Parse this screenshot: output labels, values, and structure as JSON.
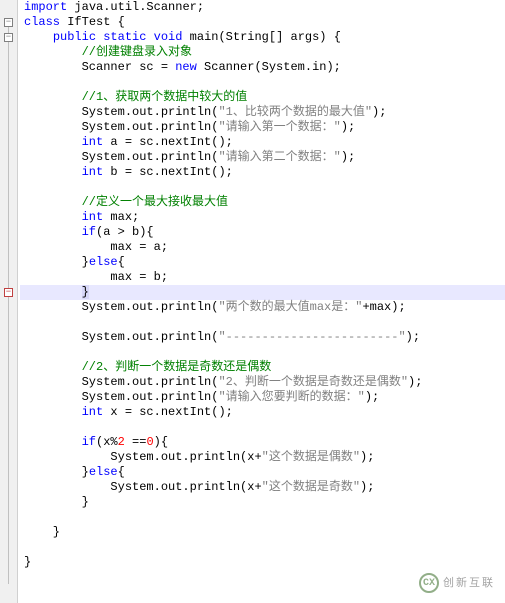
{
  "code": {
    "lines": [
      {
        "tokens": [
          {
            "t": "import",
            "c": "kw"
          },
          {
            "t": " java.util.Scanner;",
            "c": ""
          }
        ]
      },
      {
        "tokens": [
          {
            "t": "class",
            "c": "kw"
          },
          {
            "t": " IfTest {",
            "c": ""
          }
        ]
      },
      {
        "tokens": [
          {
            "t": "    ",
            "c": ""
          },
          {
            "t": "public",
            "c": "kw"
          },
          {
            "t": " ",
            "c": ""
          },
          {
            "t": "static",
            "c": "kw"
          },
          {
            "t": " ",
            "c": ""
          },
          {
            "t": "void",
            "c": "kw"
          },
          {
            "t": " main(String[] args) {",
            "c": ""
          }
        ]
      },
      {
        "tokens": [
          {
            "t": "        ",
            "c": ""
          },
          {
            "t": "//创建键盘录入对象",
            "c": "comment"
          }
        ]
      },
      {
        "tokens": [
          {
            "t": "        Scanner sc = ",
            "c": ""
          },
          {
            "t": "new",
            "c": "kw"
          },
          {
            "t": " Scanner(System.in);",
            "c": ""
          }
        ]
      },
      {
        "tokens": [
          {
            "t": " ",
            "c": ""
          }
        ]
      },
      {
        "tokens": [
          {
            "t": "        ",
            "c": ""
          },
          {
            "t": "//1、获取两个数据中较大的值",
            "c": "comment"
          }
        ]
      },
      {
        "tokens": [
          {
            "t": "        System.out.println(",
            "c": ""
          },
          {
            "t": "\"1、比较两个数据的最大值\"",
            "c": "str"
          },
          {
            "t": ");",
            "c": ""
          }
        ]
      },
      {
        "tokens": [
          {
            "t": "        System.out.println(",
            "c": ""
          },
          {
            "t": "\"请输入第一个数据：\"",
            "c": "str"
          },
          {
            "t": ");",
            "c": ""
          }
        ]
      },
      {
        "tokens": [
          {
            "t": "        ",
            "c": ""
          },
          {
            "t": "int",
            "c": "kw"
          },
          {
            "t": " a = sc.nextInt();",
            "c": ""
          }
        ]
      },
      {
        "tokens": [
          {
            "t": "        System.out.println(",
            "c": ""
          },
          {
            "t": "\"请输入第二个数据：\"",
            "c": "str"
          },
          {
            "t": ");",
            "c": ""
          }
        ]
      },
      {
        "tokens": [
          {
            "t": "        ",
            "c": ""
          },
          {
            "t": "int",
            "c": "kw"
          },
          {
            "t": " b = sc.nextInt();",
            "c": ""
          }
        ]
      },
      {
        "tokens": [
          {
            "t": " ",
            "c": ""
          }
        ]
      },
      {
        "tokens": [
          {
            "t": "        ",
            "c": ""
          },
          {
            "t": "//定义一个最大接收最大值",
            "c": "comment"
          }
        ]
      },
      {
        "tokens": [
          {
            "t": "        ",
            "c": ""
          },
          {
            "t": "int",
            "c": "kw"
          },
          {
            "t": " max;",
            "c": ""
          }
        ]
      },
      {
        "tokens": [
          {
            "t": "        ",
            "c": ""
          },
          {
            "t": "if",
            "c": "kw"
          },
          {
            "t": "(a > b){",
            "c": ""
          }
        ]
      },
      {
        "tokens": [
          {
            "t": "            max = a;",
            "c": ""
          }
        ]
      },
      {
        "tokens": [
          {
            "t": "        }",
            "c": ""
          },
          {
            "t": "else",
            "c": "kw"
          },
          {
            "t": "{",
            "c": ""
          }
        ]
      },
      {
        "tokens": [
          {
            "t": "            max = b;",
            "c": ""
          }
        ]
      },
      {
        "tokens": [
          {
            "t": "        ",
            "c": ""
          },
          {
            "t": "}",
            "c": "",
            "bh": true
          }
        ],
        "hl": true
      },
      {
        "tokens": [
          {
            "t": "        System.out.println(",
            "c": ""
          },
          {
            "t": "\"两个数的最大值max是：\"",
            "c": "str"
          },
          {
            "t": "+max);",
            "c": ""
          }
        ]
      },
      {
        "tokens": [
          {
            "t": " ",
            "c": ""
          }
        ]
      },
      {
        "tokens": [
          {
            "t": "        System.out.println(",
            "c": ""
          },
          {
            "t": "\"------------------------\"",
            "c": "str"
          },
          {
            "t": ");",
            "c": ""
          }
        ]
      },
      {
        "tokens": [
          {
            "t": " ",
            "c": ""
          }
        ]
      },
      {
        "tokens": [
          {
            "t": "        ",
            "c": ""
          },
          {
            "t": "//2、判断一个数据是奇数还是偶数",
            "c": "comment"
          }
        ]
      },
      {
        "tokens": [
          {
            "t": "        System.out.println(",
            "c": ""
          },
          {
            "t": "\"2、判断一个数据是奇数还是偶数\"",
            "c": "str"
          },
          {
            "t": ");",
            "c": ""
          }
        ]
      },
      {
        "tokens": [
          {
            "t": "        System.out.println(",
            "c": ""
          },
          {
            "t": "\"请输入您要判断的数据：\"",
            "c": "str"
          },
          {
            "t": ");",
            "c": ""
          }
        ]
      },
      {
        "tokens": [
          {
            "t": "        ",
            "c": ""
          },
          {
            "t": "int",
            "c": "kw"
          },
          {
            "t": " x = sc.nextInt();",
            "c": ""
          }
        ]
      },
      {
        "tokens": [
          {
            "t": " ",
            "c": ""
          }
        ]
      },
      {
        "tokens": [
          {
            "t": "        ",
            "c": ""
          },
          {
            "t": "if",
            "c": "kw"
          },
          {
            "t": "(x%",
            "c": ""
          },
          {
            "t": "2",
            "c": "num"
          },
          {
            "t": " ==",
            "c": ""
          },
          {
            "t": "0",
            "c": "num"
          },
          {
            "t": "){",
            "c": ""
          }
        ]
      },
      {
        "tokens": [
          {
            "t": "            System.out.println(x+",
            "c": ""
          },
          {
            "t": "\"这个数据是偶数\"",
            "c": "str"
          },
          {
            "t": ");",
            "c": ""
          }
        ]
      },
      {
        "tokens": [
          {
            "t": "        }",
            "c": ""
          },
          {
            "t": "else",
            "c": "kw"
          },
          {
            "t": "{",
            "c": ""
          }
        ]
      },
      {
        "tokens": [
          {
            "t": "            System.out.println(x+",
            "c": ""
          },
          {
            "t": "\"这个数据是奇数\"",
            "c": "str"
          },
          {
            "t": ");",
            "c": ""
          }
        ]
      },
      {
        "tokens": [
          {
            "t": "        }",
            "c": ""
          }
        ]
      },
      {
        "tokens": [
          {
            "t": " ",
            "c": ""
          }
        ]
      },
      {
        "tokens": [
          {
            "t": "    }",
            "c": ""
          }
        ]
      },
      {
        "tokens": [
          {
            "t": " ",
            "c": ""
          }
        ]
      },
      {
        "tokens": [
          {
            "t": "}",
            "c": ""
          }
        ]
      }
    ]
  },
  "fold_markers": [
    {
      "line": 1,
      "sym": "−"
    },
    {
      "line": 2,
      "sym": "−"
    }
  ],
  "indicator": {
    "line": 19,
    "sym": "−"
  },
  "watermark": {
    "logo": "CX",
    "text": "创新互联"
  }
}
